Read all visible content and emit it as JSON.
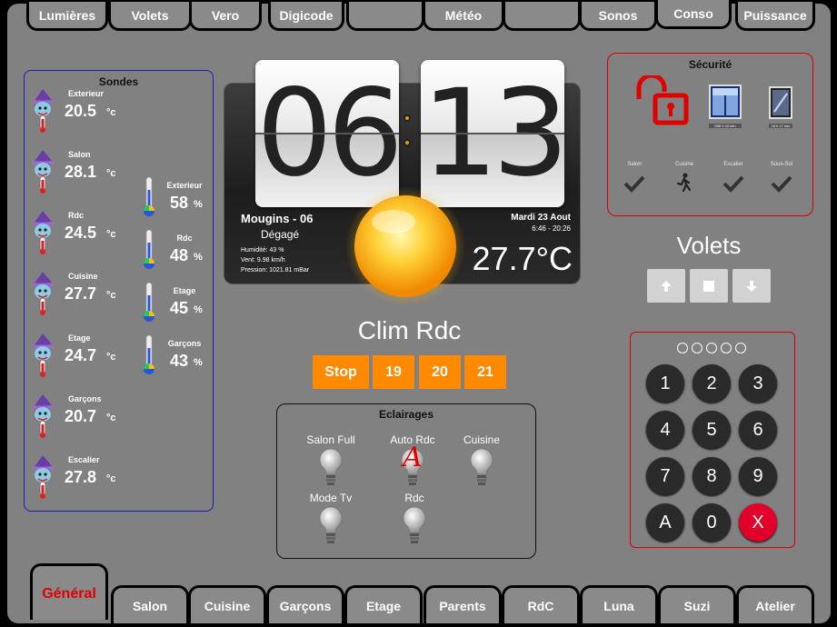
{
  "top_tabs": [
    "Lumières",
    "Volets",
    "Vero",
    "Digicode",
    "",
    "Météo",
    "",
    "Sonos",
    "Conso",
    "Puissance"
  ],
  "bottom_tabs": [
    "Général",
    "Salon",
    "Cuisine",
    "Garçons",
    "Etage",
    "Parents",
    "RdC",
    "Luna",
    "Suzi",
    "Atelier"
  ],
  "sondes": {
    "title": "Sondes",
    "temps": [
      {
        "label": "Exterieur",
        "value": "20.5",
        "unit": "°c"
      },
      {
        "label": "Salon",
        "value": "28.1",
        "unit": "°c"
      },
      {
        "label": "Rdc",
        "value": "24.5",
        "unit": "°c"
      },
      {
        "label": "Cuisine",
        "value": "27.7",
        "unit": "°c"
      },
      {
        "label": "Etage",
        "value": "24.7",
        "unit": "°c"
      },
      {
        "label": "Garçons",
        "value": "20.7",
        "unit": "°c"
      },
      {
        "label": "Escalier",
        "value": "27.8",
        "unit": "°c"
      }
    ],
    "humidity": [
      {
        "label": "Exterieur",
        "value": "58",
        "unit": "%"
      },
      {
        "label": "Rdc",
        "value": "48",
        "unit": "%"
      },
      {
        "label": "Etage",
        "value": "45",
        "unit": "%"
      },
      {
        "label": "Garçons",
        "value": "43",
        "unit": "%"
      }
    ]
  },
  "clock": {
    "hours": "06",
    "minutes": "13",
    "city": "Mougins - 06",
    "condition": "Dégagé",
    "humidity": "Humidité: 43 %",
    "wind": "Vent: 9.98 km/h",
    "pressure": "Pression: 1021.81 mBar",
    "date": "Mardi 23 Aout",
    "sun": "6:46 - 20:26",
    "temperature": "27.7°C"
  },
  "clim": {
    "title": "Clim Rdc",
    "buttons": [
      "Stop",
      "19",
      "20",
      "21"
    ],
    "color": "#ff8a00"
  },
  "eclairages": {
    "title": "Eclairages",
    "lights": [
      "Salon Full",
      "Auto Rdc",
      "Cuisine",
      "Mode Tv",
      "Rdc"
    ],
    "auto_badge": "A"
  },
  "securite": {
    "title": "Sécurité",
    "window_captions": [
      "658 h 43 min",
      "18 h 17 min"
    ],
    "sensors": [
      "Salon",
      "Cuisine",
      "Escalier",
      "Sous-Sol"
    ],
    "alert_color": "#e00000"
  },
  "volets": {
    "title": "Volets"
  },
  "keypad": {
    "keys": [
      "1",
      "2",
      "3",
      "4",
      "5",
      "6",
      "7",
      "8",
      "9",
      "A",
      "0",
      "X"
    ],
    "pin_dots": 5
  }
}
